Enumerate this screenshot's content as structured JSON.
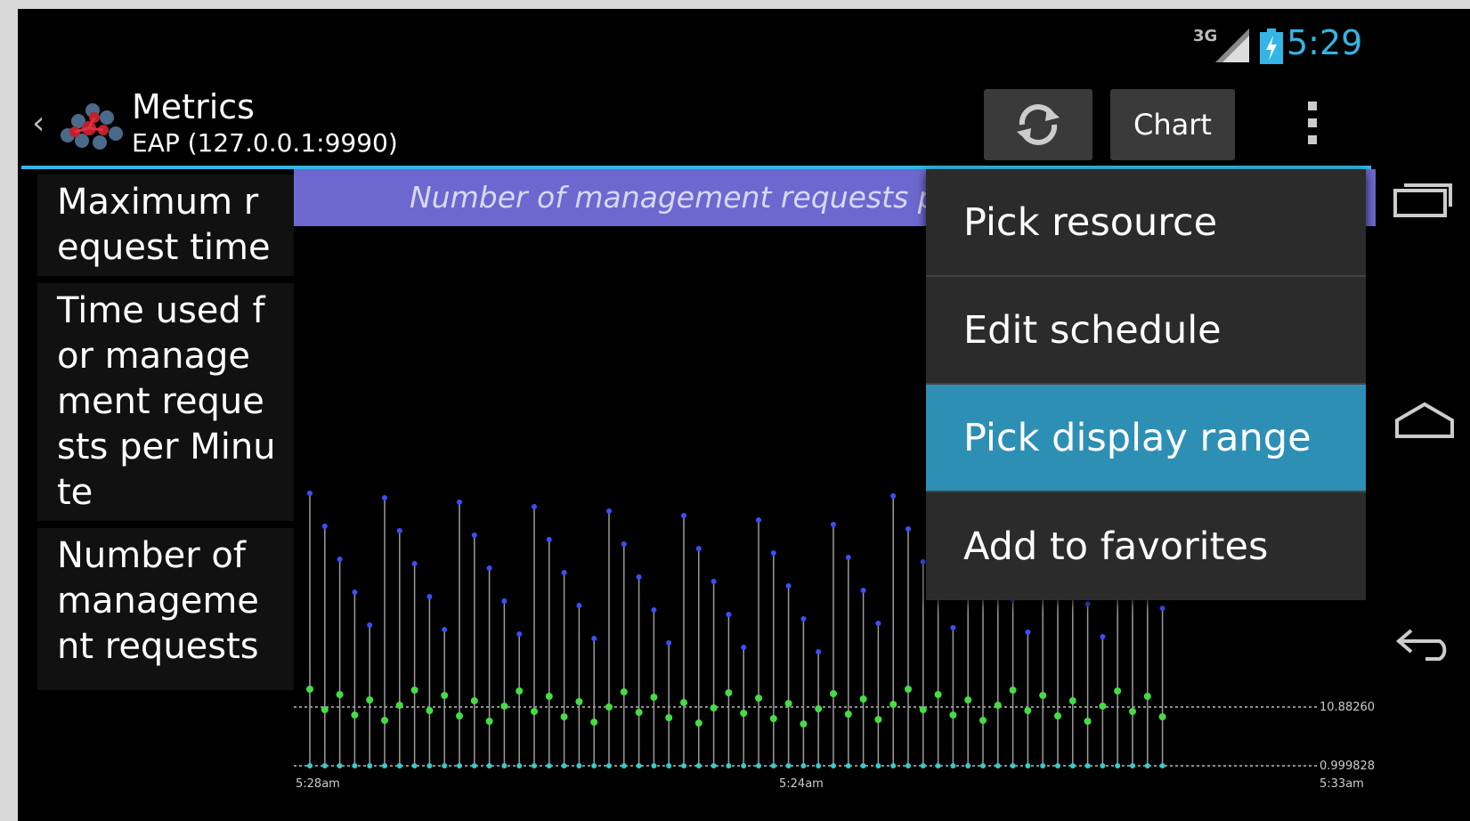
{
  "status_bar": {
    "network_label": "3G",
    "time": "5:29"
  },
  "action_bar": {
    "title": "Metrics",
    "subtitle": "EAP (127.0.0.1:9990)",
    "chart_label": "Chart"
  },
  "metrics": [
    "Maximum request time",
    "Time used for management requests per Minute",
    "Number of management requests"
  ],
  "chart": {
    "title": "Number of management requests p",
    "y_labels": [
      "10.882609",
      "0.9998282"
    ],
    "x_labels": [
      "5:28am",
      "5:24am",
      "5:33am"
    ]
  },
  "menu": {
    "items": [
      {
        "label": "Pick resource",
        "highlighted": false
      },
      {
        "label": "Edit schedule",
        "highlighted": false
      },
      {
        "label": "Pick display range",
        "highlighted": true
      },
      {
        "label": "Add to favorites",
        "highlighted": false
      }
    ]
  },
  "colors": {
    "accent": "#33b5e5",
    "chart_header": "#6c68d0",
    "menu_highlight": "#2e8fb5"
  }
}
